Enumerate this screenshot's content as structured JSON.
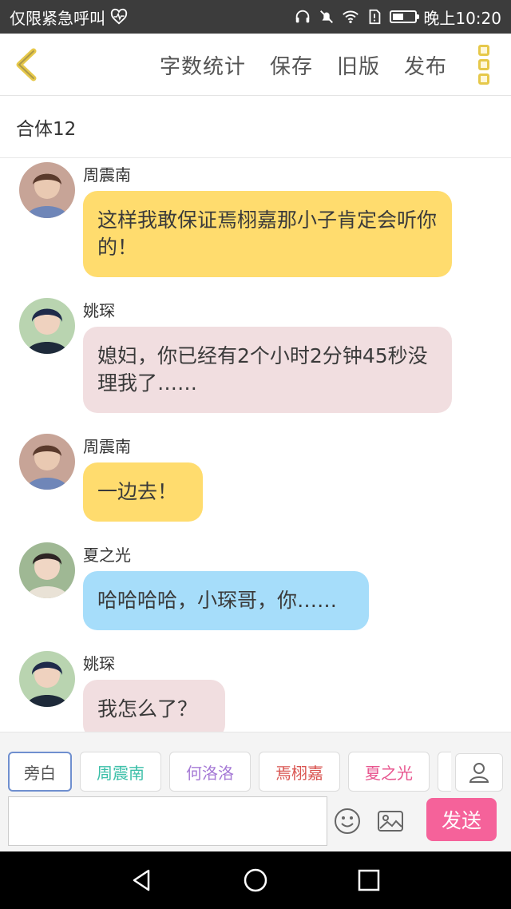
{
  "status_bar": {
    "left_text": "仅限紧急呼叫",
    "time": "晚上10:20",
    "icons": [
      "heartbeat-icon",
      "headset-icon",
      "mute-icon",
      "wifi-icon",
      "sim-alert-icon",
      "battery-icon"
    ],
    "battery_level": 0.5
  },
  "toolbar": {
    "back_icon": "chevron-left-icon",
    "actions": [
      "字数统计",
      "保存",
      "旧版",
      "发布"
    ],
    "more_icon": "more-vertical-icon",
    "accent_color": "#e6c84a"
  },
  "title": "合体12",
  "messages": [
    {
      "sender": "周震南",
      "text": "这样我敢保证焉栩嘉那小子肯定会听你的！",
      "color": "#ffdc6e"
    },
    {
      "sender": "姚琛",
      "text": "媳妇，你已经有2个小时2分钟45秒没理我了……",
      "color": "#f1dee0"
    },
    {
      "sender": "周震南",
      "text": "一边去！",
      "color": "#ffdc6e"
    },
    {
      "sender": "夏之光",
      "text": "哈哈哈哈，小琛哥，你……",
      "color": "#a6ddfa"
    },
    {
      "sender": "姚琛",
      "text": "我怎么了？",
      "color": "#f1dee0"
    }
  ],
  "composer": {
    "characters": [
      {
        "label": "旁白",
        "color": "#555555"
      },
      {
        "label": "周震南",
        "color": "#3bbfa8"
      },
      {
        "label": "何洛洛",
        "color": "#a67ad6"
      },
      {
        "label": "焉栩嘉",
        "color": "#d9534f"
      },
      {
        "label": "夏之光",
        "color": "#e8568f"
      }
    ],
    "input_value": "",
    "send_label": "发送",
    "send_color": "#f5629a"
  }
}
